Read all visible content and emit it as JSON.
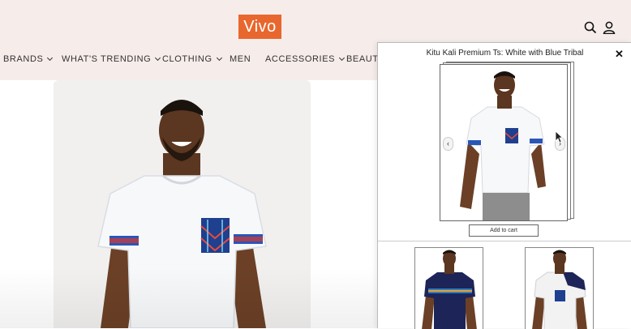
{
  "brand": {
    "logo_text": "Vivo",
    "accent": "#e8672e",
    "header_bg": "#f6ecea"
  },
  "nav": {
    "items": [
      {
        "label": "BRANDS",
        "has_dropdown": true
      },
      {
        "label": "WHAT'S TRENDING",
        "has_dropdown": true
      },
      {
        "label": "CLOTHING",
        "has_dropdown": true
      },
      {
        "label": "MEN",
        "has_dropdown": false
      },
      {
        "label": "ACCESSORIES",
        "has_dropdown": true
      },
      {
        "label": "BEAUTY",
        "has_dropdown": false
      }
    ]
  },
  "header_icons": [
    "search-icon",
    "user-icon"
  ],
  "modal": {
    "title": "Kitu Kali Premium Ts: White with Blue Tribal",
    "close_label": "✕",
    "prev_label": "‹",
    "next_label": "›",
    "add_to_cart_label": "Add to cart",
    "thumbnails": [
      "navy-tribal-tshirt",
      "white-tribal-shoulder-tshirt"
    ]
  }
}
